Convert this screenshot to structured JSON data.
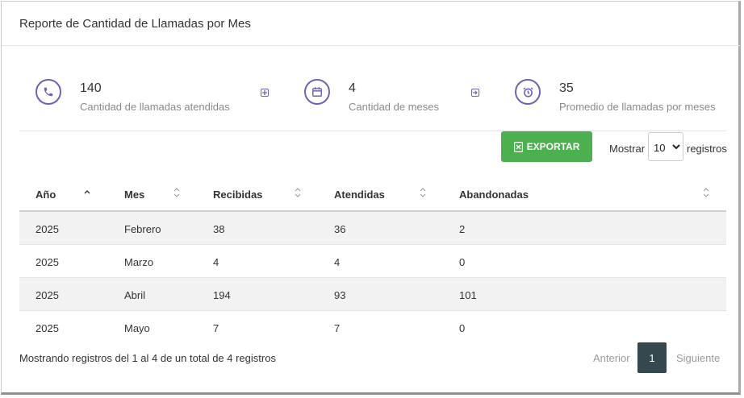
{
  "header": {
    "title": "Reporte de Cantidad de Llamadas por Mes"
  },
  "stats": [
    {
      "icon": "phone-icon",
      "value": "140",
      "label": "Cantidad de llamadas atendidas"
    },
    {
      "icon": "calendar-icon",
      "value": "4",
      "label": "Cantidad de meses"
    },
    {
      "icon": "alarm-clock-icon",
      "value": "35",
      "label": "Promedio de llamadas por meses"
    }
  ],
  "toolbar": {
    "export_label": "EXPORTAR",
    "show_label": "Mostrar",
    "page_size": "10",
    "records_label": "registros"
  },
  "table": {
    "columns": [
      "Año",
      "Mes",
      "Recibidas",
      "Atendidas",
      "Abandonadas"
    ],
    "rows": [
      [
        "2025",
        "Febrero",
        "38",
        "36",
        "2"
      ],
      [
        "2025",
        "Marzo",
        "4",
        "4",
        "0"
      ],
      [
        "2025",
        "Abril",
        "194",
        "93",
        "101"
      ],
      [
        "2025",
        "Mayo",
        "7",
        "7",
        "0"
      ]
    ]
  },
  "footer": {
    "summary": "Mostrando registros del 1 al 4 de un total de 4 registros",
    "prev_label": "Anterior",
    "current_page": "1",
    "next_label": "Siguiente"
  },
  "colors": {
    "accent": "#6a64b5",
    "export": "#4caf50",
    "pager_active": "#35474f"
  }
}
